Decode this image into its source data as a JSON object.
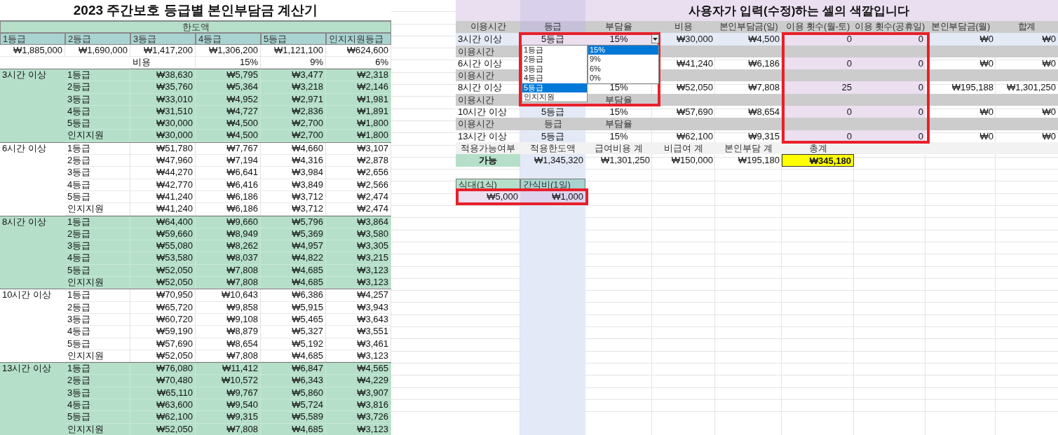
{
  "left": {
    "title": "2023 주간보호 등급별 본인부담금 계산기",
    "limit_header": "한도액",
    "grades": [
      "1등급",
      "2등급",
      "3등급",
      "4등급",
      "5등급",
      "인지지원등급"
    ],
    "limits": [
      "₩1,885,000",
      "₩1,690,000",
      "₩1,417,200",
      "₩1,306,200",
      "₩1,121,100",
      "₩624,600"
    ],
    "cost_label": "비용",
    "rates": [
      "15%",
      "9%",
      "6%"
    ],
    "groups": [
      {
        "label": "3시간 이상",
        "shaded": true,
        "rows": [
          [
            "1등급",
            "₩38,630",
            "₩5,795",
            "₩3,477",
            "₩2,318"
          ],
          [
            "2등급",
            "₩35,760",
            "₩5,364",
            "₩3,218",
            "₩2,146"
          ],
          [
            "3등급",
            "₩33,010",
            "₩4,952",
            "₩2,971",
            "₩1,981"
          ],
          [
            "4등급",
            "₩31,510",
            "₩4,727",
            "₩2,836",
            "₩1,891"
          ],
          [
            "5등급",
            "₩30,000",
            "₩4,500",
            "₩2,700",
            "₩1,800"
          ],
          [
            "인지지원",
            "₩30,000",
            "₩4,500",
            "₩2,700",
            "₩1,800"
          ]
        ]
      },
      {
        "label": "6시간 이상",
        "shaded": false,
        "rows": [
          [
            "1등급",
            "₩51,780",
            "₩7,767",
            "₩4,660",
            "₩3,107"
          ],
          [
            "2등급",
            "₩47,960",
            "₩7,194",
            "₩4,316",
            "₩2,878"
          ],
          [
            "3등급",
            "₩44,270",
            "₩6,641",
            "₩3,984",
            "₩2,656"
          ],
          [
            "4등급",
            "₩42,770",
            "₩6,416",
            "₩3,849",
            "₩2,566"
          ],
          [
            "5등급",
            "₩41,240",
            "₩6,186",
            "₩3,712",
            "₩2,474"
          ],
          [
            "인지지원",
            "₩41,240",
            "₩6,186",
            "₩3,712",
            "₩2,474"
          ]
        ]
      },
      {
        "label": "8시간 이상",
        "shaded": true,
        "rows": [
          [
            "1등급",
            "₩64,400",
            "₩9,660",
            "₩5,796",
            "₩3,864"
          ],
          [
            "2등급",
            "₩59,660",
            "₩8,949",
            "₩5,369",
            "₩3,580"
          ],
          [
            "3등급",
            "₩55,080",
            "₩8,262",
            "₩4,957",
            "₩3,305"
          ],
          [
            "4등급",
            "₩53,580",
            "₩8,037",
            "₩4,822",
            "₩3,215"
          ],
          [
            "5등급",
            "₩52,050",
            "₩7,808",
            "₩4,685",
            "₩3,123"
          ],
          [
            "인지지원",
            "₩52,050",
            "₩7,808",
            "₩4,685",
            "₩3,123"
          ]
        ]
      },
      {
        "label": "10시간 이상",
        "shaded": false,
        "rows": [
          [
            "1등급",
            "₩70,950",
            "₩10,643",
            "₩6,386",
            "₩4,257"
          ],
          [
            "2등급",
            "₩65,720",
            "₩9,858",
            "₩5,915",
            "₩3,943"
          ],
          [
            "3등급",
            "₩60,720",
            "₩9,108",
            "₩5,465",
            "₩3,643"
          ],
          [
            "4등급",
            "₩59,190",
            "₩8,879",
            "₩5,327",
            "₩3,551"
          ],
          [
            "5등급",
            "₩57,690",
            "₩8,654",
            "₩5,192",
            "₩3,461"
          ],
          [
            "인지지원",
            "₩52,050",
            "₩7,808",
            "₩4,685",
            "₩3,123"
          ]
        ]
      },
      {
        "label": "13시간 이상",
        "shaded": true,
        "rows": [
          [
            "1등급",
            "₩76,080",
            "₩11,412",
            "₩6,847",
            "₩4,565"
          ],
          [
            "2등급",
            "₩70,480",
            "₩10,572",
            "₩6,343",
            "₩4,229"
          ],
          [
            "3등급",
            "₩65,110",
            "₩9,767",
            "₩5,860",
            "₩3,907"
          ],
          [
            "4등급",
            "₩63,600",
            "₩9,540",
            "₩5,724",
            "₩3,816"
          ],
          [
            "5등급",
            "₩62,100",
            "₩9,315",
            "₩5,589",
            "₩3,726"
          ],
          [
            "인지지원",
            "₩52,050",
            "₩7,808",
            "₩4,685",
            "₩3,123"
          ]
        ]
      }
    ]
  },
  "right": {
    "title": "사용자가 입력(수정)하는 셀의 색깔입니다",
    "columns": [
      "이용시간",
      "등급",
      "부담율",
      "비용",
      "본인부담금(일)",
      "이용 횟수(월-토)",
      "이용 횟수(공휴일)",
      "본인부담금(월)",
      "합계"
    ],
    "rows": [
      {
        "kind": "data",
        "selected": true,
        "cells": [
          "3시간 이상",
          "5등급",
          "15%",
          "₩30,000",
          "₩4,500",
          "0",
          "0",
          "₩0",
          "₩0"
        ]
      },
      {
        "kind": "label",
        "cells": [
          "이용시간"
        ]
      },
      {
        "kind": "data",
        "selected": false,
        "cells": [
          "6시간 이상",
          null,
          null,
          "₩41,240",
          "₩6,186",
          "0",
          "0",
          "₩0",
          "₩0"
        ]
      },
      {
        "kind": "label",
        "cells": [
          "이용시간"
        ]
      },
      {
        "kind": "data",
        "selected": false,
        "cells": [
          "8시간 이상",
          null,
          "15%",
          "₩52,050",
          "₩7,808",
          "25",
          "0",
          "₩195,188",
          "₩1,301,250"
        ]
      },
      {
        "kind": "label",
        "cells": [
          "이용시간",
          null,
          "부담율"
        ]
      },
      {
        "kind": "data",
        "selected": false,
        "cells": [
          "10시간 이상",
          "5등급",
          "15%",
          "₩57,690",
          "₩8,654",
          "0",
          "0",
          "₩0",
          "₩0"
        ]
      },
      {
        "kind": "label",
        "cells": [
          "이용시간",
          "등급",
          "부담율"
        ]
      },
      {
        "kind": "data",
        "selected": false,
        "cells": [
          "13시간 이상",
          "5등급",
          "15%",
          "₩62,100",
          "₩9,315",
          "0",
          "0",
          "₩0",
          "₩0"
        ]
      }
    ],
    "summary": [
      {
        "label": "적용가능여부",
        "value": "가능",
        "kind": "status"
      },
      {
        "label": "적용한도액",
        "value": "₩1,345,320",
        "kind": "amount"
      },
      {
        "label": "급여비용 계",
        "value": "₩1,301,250",
        "kind": "amount"
      },
      {
        "label": "비급여 계",
        "value": "₩150,000",
        "kind": "amount"
      },
      {
        "label": "본인부담 계",
        "value": "₩195,180",
        "kind": "amount"
      },
      {
        "label": "총계",
        "value": "₩345,180",
        "kind": "total"
      }
    ],
    "meals": [
      {
        "label": "식대(1식)",
        "value": "₩5,000"
      },
      {
        "label": "간식비(1일)",
        "value": "₩1,000"
      }
    ],
    "grade_dropdown": [
      {
        "label": "1등급",
        "selected": false
      },
      {
        "label": "2등급",
        "selected": false
      },
      {
        "label": "3등급",
        "selected": false
      },
      {
        "label": "4등급",
        "selected": false
      },
      {
        "label": "5등급",
        "selected": true
      },
      {
        "label": "인지지원",
        "selected": false
      }
    ],
    "rate_dropdown": [
      {
        "label": "15%",
        "selected": true
      },
      {
        "label": "9%",
        "selected": false
      },
      {
        "label": "6%",
        "selected": false
      },
      {
        "label": "0%",
        "selected": false
      }
    ],
    "frames": [
      {
        "kind": "selectors"
      },
      {
        "kind": "counts"
      },
      {
        "kind": "meals"
      }
    ]
  }
}
